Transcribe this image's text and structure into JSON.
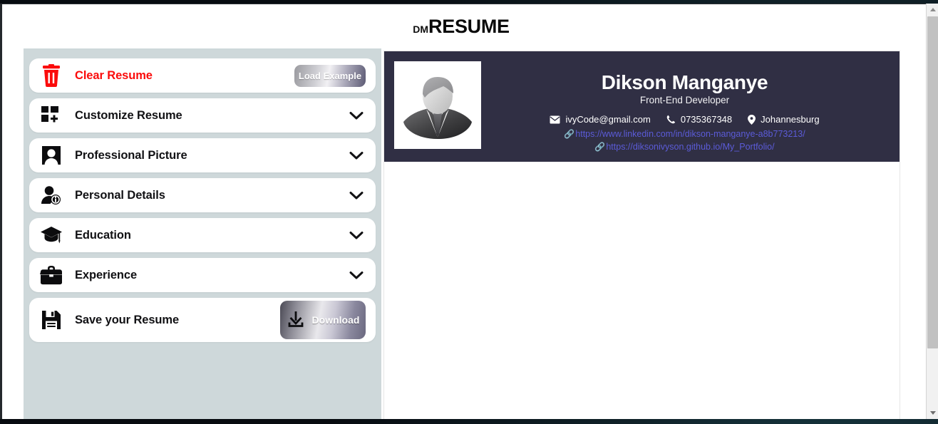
{
  "header": {
    "brand_prefix": "DM",
    "brand_main": "RESUME"
  },
  "sidebar": {
    "items": [
      {
        "label": "Clear Resume",
        "icon": "trash-icon",
        "style": "danger",
        "action_label": "Load Example",
        "action_name": "load-example-button"
      },
      {
        "label": "Customize Resume",
        "icon": "grid-plus-icon",
        "control": "chevron-down-icon"
      },
      {
        "label": "Professional Picture",
        "icon": "portrait-icon",
        "control": "chevron-down-icon"
      },
      {
        "label": "Personal Details",
        "icon": "user-info-icon",
        "control": "chevron-down-icon"
      },
      {
        "label": "Education",
        "icon": "graduation-cap-icon",
        "control": "chevron-down-icon"
      },
      {
        "label": "Experience",
        "icon": "briefcase-icon",
        "control": "chevron-down-icon"
      },
      {
        "label": "Save your Resume",
        "icon": "floppy-disk-icon",
        "action_label": "Download",
        "action_name": "download-button"
      }
    ]
  },
  "resume": {
    "name": "Dikson Manganye",
    "role": "Front-End Developer",
    "avatar_alt": "placeholder-profile-photo",
    "contacts": [
      {
        "icon": "envelope-icon",
        "value": "ivyCode@gmail.com"
      },
      {
        "icon": "phone-icon",
        "value": "0735367348"
      },
      {
        "icon": "location-pin-icon",
        "value": "Johannesburg"
      }
    ],
    "links": [
      {
        "icon": "link-icon",
        "url": "https://www.linkedin.com/in/dikson-manganye-a8b773213/"
      },
      {
        "icon": "link-icon",
        "url": "https://diksonivyson.github.io/My_Portfolio/"
      }
    ]
  },
  "colors": {
    "resume_header_bg": "#302f44",
    "sidebar_bg": "#ced8da",
    "danger": "#fb0b0b",
    "link": "#5b5bd8",
    "page_bg": "#ffffff"
  },
  "scrollbar": {
    "up_arrow": "scroll-up-arrow",
    "down_arrow": "scroll-down-arrow"
  }
}
